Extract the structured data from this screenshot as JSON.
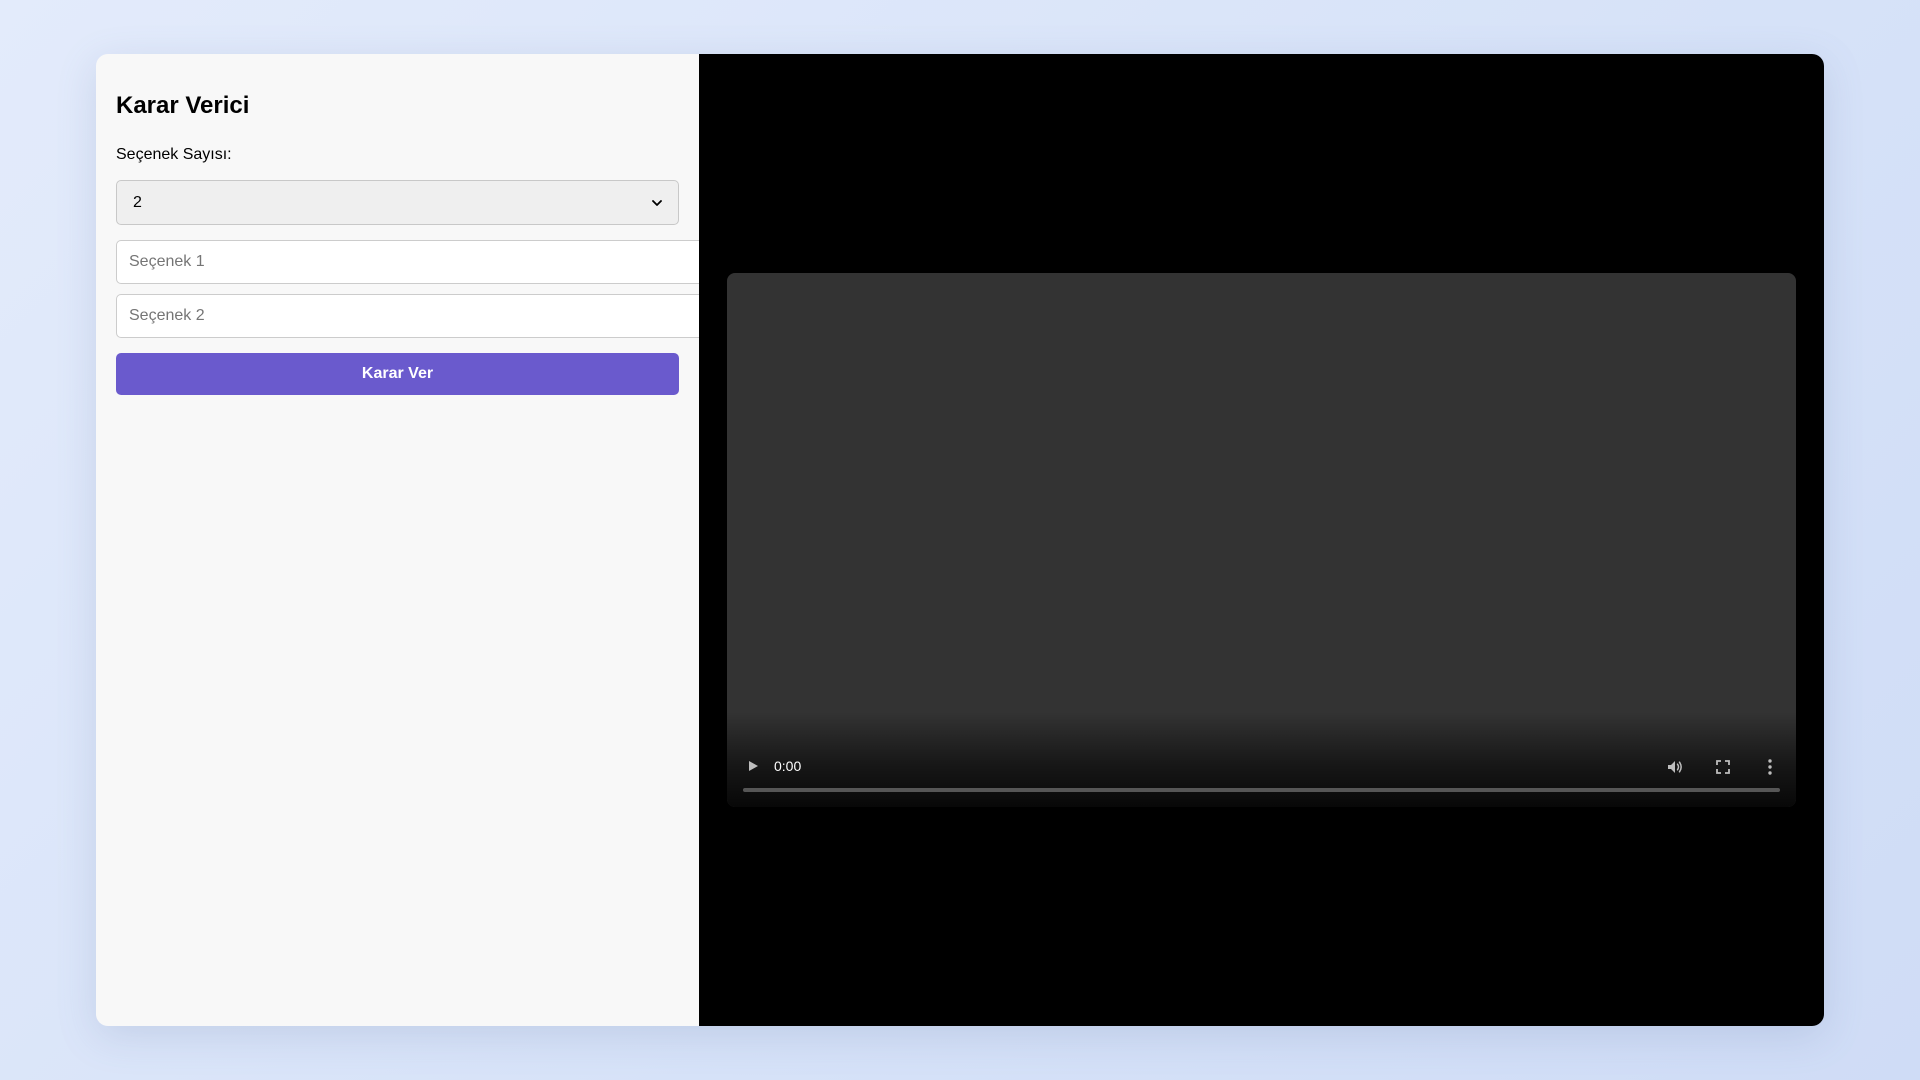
{
  "app": {
    "title": "Karar Verici"
  },
  "form": {
    "count_label": "Seçenek Sayısı:",
    "count_selected": "2",
    "options": [
      {
        "value": "",
        "placeholder": "Seçenek 1"
      },
      {
        "value": "",
        "placeholder": "Seçenek 2"
      }
    ],
    "submit_label": "Karar Ver"
  },
  "video": {
    "current_time": "0:00",
    "progress": 0,
    "icons": {
      "play": "play-icon",
      "volume": "volume-icon",
      "fullscreen": "fullscreen-icon",
      "more": "more-options-icon"
    }
  },
  "colors": {
    "accent": "#6a5acd",
    "panel_background": "#f8f8f8",
    "video_background": "#000000",
    "player_surface": "#333333"
  }
}
